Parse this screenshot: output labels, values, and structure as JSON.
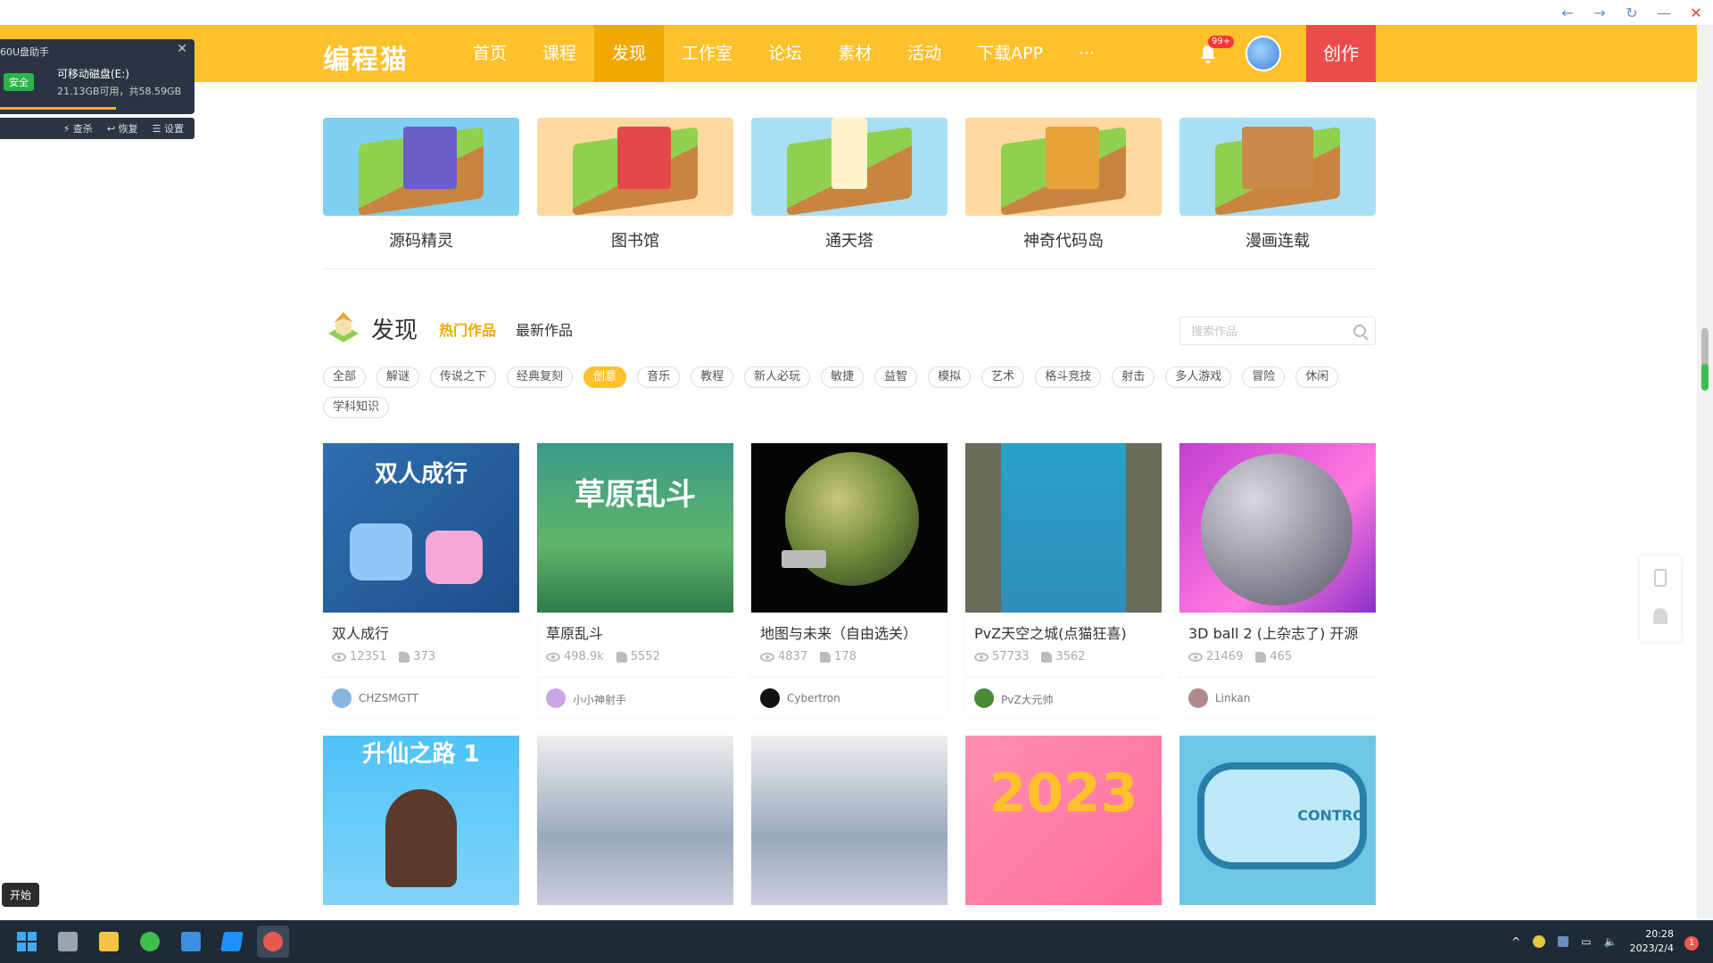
{
  "nav": {
    "logo": "编程猫",
    "items": [
      "首页",
      "课程",
      "发现",
      "工作室",
      "论坛",
      "素材",
      "活动",
      "下载APP",
      "···"
    ],
    "active_index": 2,
    "notification_badge": "99+",
    "create_label": "创作"
  },
  "usb_popup": {
    "title": "60U盘助手",
    "safe_badge": "安全",
    "drive_name": "可移动磁盘(E:)",
    "space": "21.13GB可用，共58.59GB",
    "actions": [
      "查杀",
      "恢复",
      "设置"
    ]
  },
  "features": [
    {
      "label": "源码精灵"
    },
    {
      "label": "图书馆"
    },
    {
      "label": "通天塔"
    },
    {
      "label": "神奇代码岛"
    },
    {
      "label": "漫画连载"
    }
  ],
  "discover": {
    "title": "发现",
    "tab_hot": "热门作品",
    "tab_new": "最新作品",
    "search_placeholder": "搜索作品"
  },
  "tags": [
    "全部",
    "解谜",
    "传说之下",
    "经典复刻",
    "创意",
    "音乐",
    "教程",
    "新人必玩",
    "敏捷",
    "益智",
    "模拟",
    "艺术",
    "格斗竞技",
    "射击",
    "多人游戏",
    "冒险",
    "休闲",
    "学科知识"
  ],
  "active_tag_index": 4,
  "works": [
    {
      "title": "双人成行",
      "views": "12351",
      "likes": "373",
      "author": "CHZSMGTT",
      "caption": "双人成行"
    },
    {
      "title": "草原乱斗",
      "views": "498.9k",
      "likes": "5552",
      "author": "小小神射手",
      "caption": "草原乱斗"
    },
    {
      "title": "地图与未来（自由选关）",
      "views": "4837",
      "likes": "178",
      "author": "Cybertron",
      "caption": ""
    },
    {
      "title": "PvZ天空之城(点猫狂喜)",
      "views": "57733",
      "likes": "3562",
      "author": "PvZ大元帅",
      "caption": ""
    },
    {
      "title": "3D ball 2 (上杂志了) 开源",
      "views": "21469",
      "likes": "465",
      "author": "Linkan",
      "caption": ""
    }
  ],
  "works_row2_captions": [
    "升仙之路 1",
    "",
    "",
    "2023",
    "CONTRO"
  ],
  "float": {
    "phone": "phone-icon",
    "bell": "bell-icon"
  },
  "start_tip": "开始",
  "taskbar": {
    "time": "20:28",
    "date": "2023/2/4",
    "notification_count": "1"
  }
}
